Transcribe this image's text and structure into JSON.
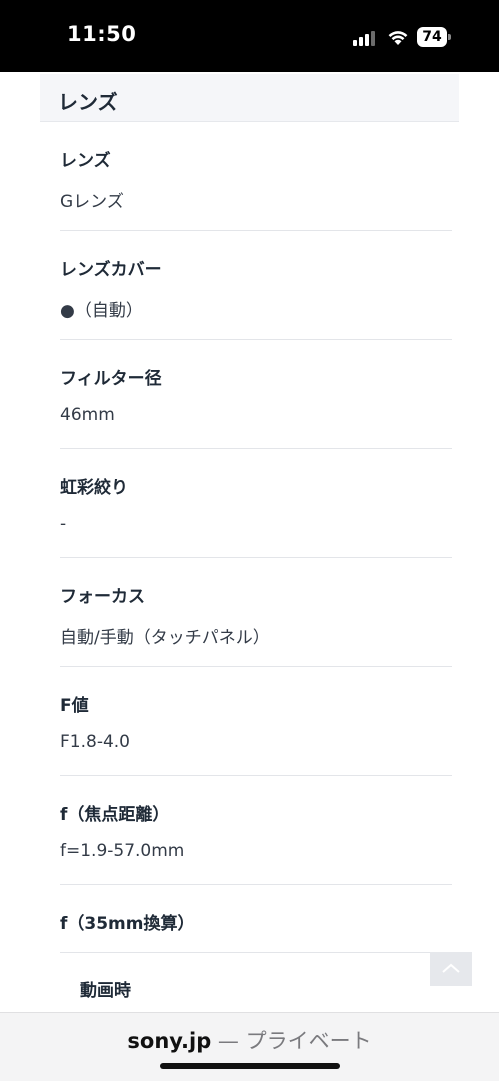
{
  "status_bar": {
    "time": "11:50",
    "battery_level": "74",
    "icons": [
      "cellular-signal-icon",
      "wifi-icon",
      "battery-icon"
    ]
  },
  "section": {
    "title": "レンズ"
  },
  "specs": [
    {
      "label": "レンズ",
      "value": "Gレンズ"
    },
    {
      "label": "レンズカバー",
      "value": "●（自動）"
    },
    {
      "label": "フィルター径",
      "value": "46mm"
    },
    {
      "label": "虹彩絞り",
      "value": "-"
    },
    {
      "label": "フォーカス",
      "value": "自動/手動（タッチパネル）"
    },
    {
      "label": "F値",
      "value": "F1.8-4.0"
    },
    {
      "label": "f（焦点距離）",
      "value": "f=1.9-57.0mm"
    },
    {
      "label": "f（35mm換算）"
    }
  ],
  "sub_spec": {
    "label": "動画時"
  },
  "browser": {
    "domain": "sony.jp",
    "separator": " — ",
    "mode": "プライベート"
  },
  "colors": {
    "status_bar_bg": "#000000",
    "header_bg": "#f5f6f9",
    "text_primary": "#1f2a37",
    "divider": "#e3e5e9",
    "scroll_button_bg": "#e6e8ec"
  }
}
